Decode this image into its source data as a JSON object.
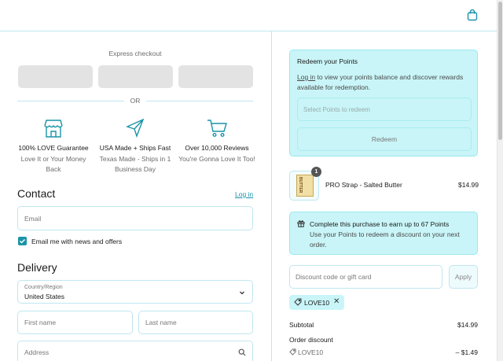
{
  "header": {
    "cart_icon": "shopping-bag-icon"
  },
  "express": {
    "title": "Express checkout",
    "or": "OR"
  },
  "features": [
    {
      "icon": "store-icon",
      "title": "100% LOVE Guarantee",
      "sub": "Love It or Your Money Back"
    },
    {
      "icon": "send-icon",
      "title": "USA Made + Ships Fast",
      "sub": "Texas Made - Ships in 1 Business Day"
    },
    {
      "icon": "cart-icon",
      "title": "Over 10,000 Reviews",
      "sub": "You're Gonna Love It Too!"
    }
  ],
  "contact": {
    "heading": "Contact",
    "login": "Log in",
    "email_placeholder": "Email",
    "newsletter_label": "Email me with news and offers",
    "newsletter_checked": true
  },
  "delivery": {
    "heading": "Delivery",
    "country_label": "Country/Region",
    "country_value": "United States",
    "first_name_placeholder": "First name",
    "last_name_placeholder": "Last name",
    "address_placeholder": "Address"
  },
  "redeem": {
    "title": "Redeem your Points",
    "login_link": "Log in",
    "desc_rest": " to view your points balance and discover rewards available for redemption.",
    "select_placeholder": "Select Points to redeem",
    "button": "Redeem"
  },
  "product": {
    "name": "PRO Strap - Salted Butter",
    "price": "$14.99",
    "qty": "1",
    "thumb_label": "BUTTER"
  },
  "points": {
    "title": "Complete this purchase to earn up to 67 Points",
    "sub": "Use your Points to redeem a discount on your next order."
  },
  "discount": {
    "placeholder": "Discount code or gift card",
    "apply": "Apply",
    "tag": "LOVE10"
  },
  "summary": {
    "subtotal_label": "Subtotal",
    "subtotal_value": "$14.99",
    "order_discount_label": "Order discount",
    "discount_code": "LOVE10",
    "discount_value": "– $1.49"
  },
  "colors": {
    "accent": "#1a94a8",
    "panel": "#c9f5f8",
    "border": "#bfe6f0"
  }
}
